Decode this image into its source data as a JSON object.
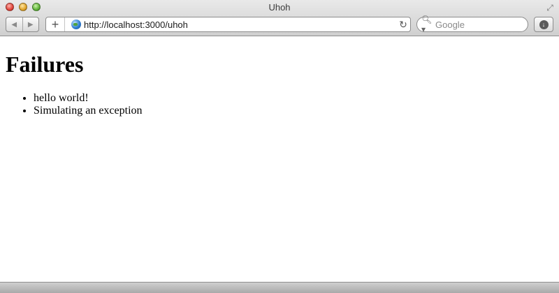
{
  "window": {
    "title": "Uhoh"
  },
  "toolbar": {
    "back_icon": "back-arrow-icon",
    "forward_icon": "forward-arrow-icon",
    "add_icon": "plus-icon",
    "add_label": "+",
    "reload_icon": "reload-icon",
    "download_icon": "download-icon"
  },
  "address": {
    "url": "http://localhost:3000/uhoh"
  },
  "search": {
    "placeholder": "Google"
  },
  "page": {
    "heading": "Failures",
    "items": [
      "hello world!",
      "Simulating an exception"
    ]
  },
  "colors": {
    "close": "#e0443a",
    "minimize": "#e0a42a",
    "zoom": "#5fb339"
  }
}
